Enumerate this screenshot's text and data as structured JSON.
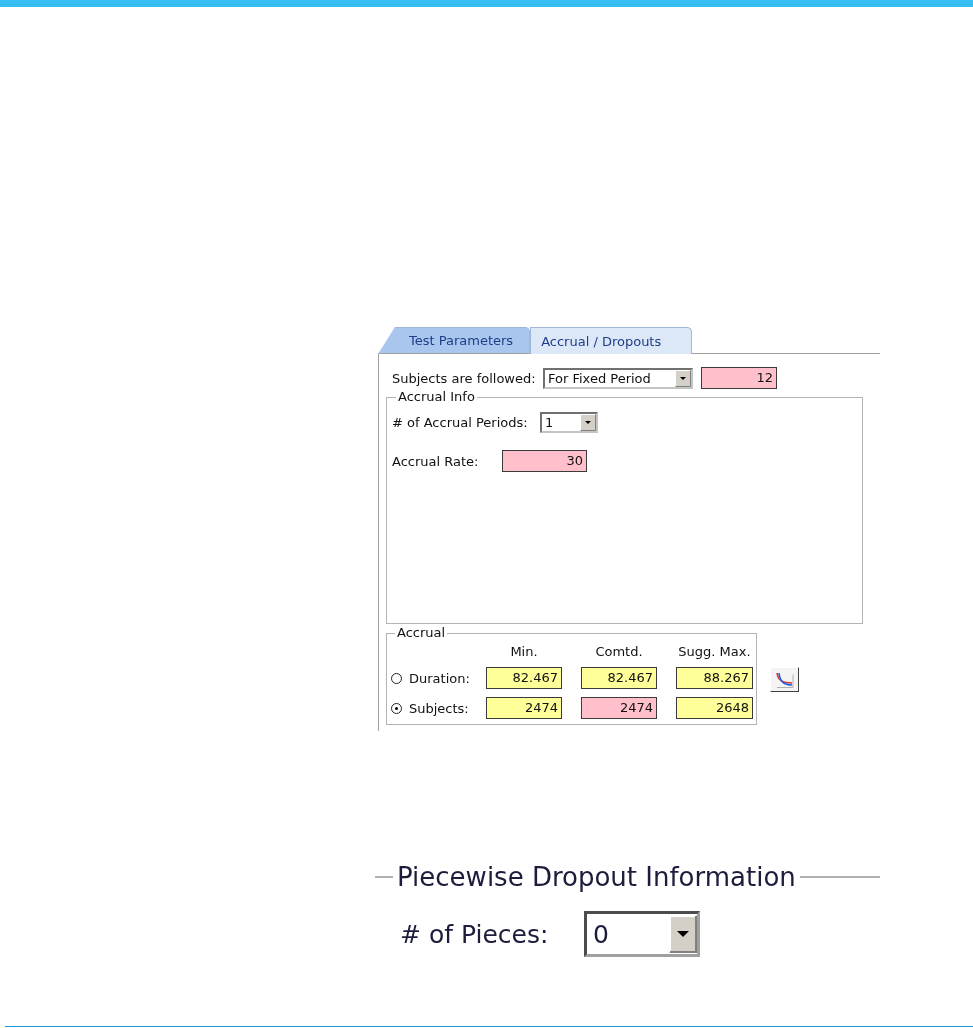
{
  "tabs": [
    {
      "label": "Test Parameters",
      "selected": false
    },
    {
      "label": "Accrual / Dropouts",
      "selected": true
    }
  ],
  "followed": {
    "label": "Subjects are followed:",
    "dropdown": "For Fixed Period",
    "value": "12"
  },
  "accrual_info": {
    "title": "Accrual Info",
    "periods": {
      "label": "# of Accrual Periods:",
      "value": "1"
    },
    "rate": {
      "label": "Accrual Rate:",
      "value": "30"
    }
  },
  "accrual": {
    "title": "Accrual",
    "columns": [
      "Min.",
      "Comtd.",
      "Sugg. Max."
    ],
    "rows": [
      {
        "label": "Duration:",
        "selected": false,
        "cells": [
          {
            "value": "82.467",
            "kind": "computed"
          },
          {
            "value": "82.467",
            "kind": "computed"
          },
          {
            "value": "88.267",
            "kind": "computed"
          }
        ]
      },
      {
        "label": "Subjects:",
        "selected": true,
        "cells": [
          {
            "value": "2474",
            "kind": "computed"
          },
          {
            "value": "2474",
            "kind": "input"
          },
          {
            "value": "2648",
            "kind": "computed"
          }
        ]
      }
    ]
  },
  "dropout": {
    "title": "Piecewise Dropout Information",
    "pieces": {
      "label": "# of Pieces:",
      "value": "0"
    }
  }
}
